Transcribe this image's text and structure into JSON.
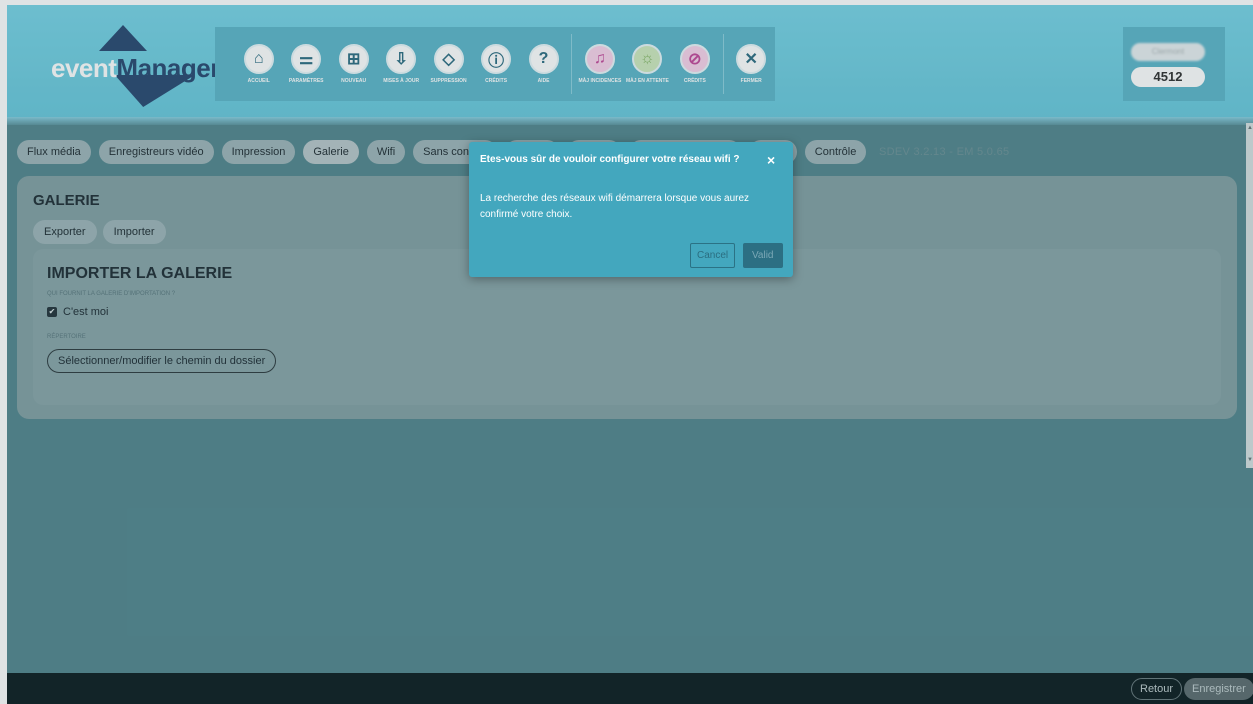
{
  "header": {
    "logo": {
      "text_left": "event",
      "text_right": "Manager"
    },
    "toolbar": [
      {
        "label": "ACCUEIL",
        "icon": "home-icon"
      },
      {
        "label": "PARAMÈTRES",
        "icon": "sliders-icon"
      },
      {
        "label": "NOUVEAU",
        "icon": "plus-square-icon"
      },
      {
        "label": "MISES À JOUR",
        "icon": "download-icon"
      },
      {
        "label": "SUPPRESSION",
        "icon": "eraser-icon"
      },
      {
        "label": "CRÉDITS",
        "icon": "info-icon"
      },
      {
        "label": "AIDE",
        "icon": "help-icon"
      },
      {
        "label": "MÀJ INCIDENCES",
        "icon": "bell-icon"
      },
      {
        "label": "MÀJ EN ATTENTE",
        "icon": "lightbulb-icon"
      },
      {
        "label": "CRÉDITS",
        "icon": "crossed-out-icon"
      },
      {
        "label": "FERMER",
        "icon": "close-circle-icon"
      }
    ],
    "account": {
      "name": "Clermont",
      "number": "4512"
    }
  },
  "tabs": [
    "Flux média",
    "Enregistreurs vidéo",
    "Impression",
    "Galerie",
    "Wifi",
    "Sans contact",
    "",
    "",
    "",
    "",
    "Contrôle"
  ],
  "active_tab": "Galerie",
  "version": "SDEV 3.2.13 - EM 5.0.65",
  "gallery": {
    "title": "GALERIE",
    "sub_tabs": [
      "Exporter",
      "Importer"
    ],
    "import": {
      "title": "IMPORTER LA GALERIE",
      "question": "QUI FOURNIT LA GALERIE D'IMPORTATION ?",
      "checkbox_label": "C'est moi",
      "directory_label": "RÉPERTOIRE",
      "path_button": "Sélectionner/modifier le chemin du dossier"
    }
  },
  "footer": {
    "back": "Retour",
    "save": "Enregistrer"
  },
  "modal": {
    "title": "Etes-vous sûr de vouloir configurer votre réseau wifi ?",
    "close": "×",
    "body": "La recherche des réseaux wifi démarrera lorsque vous aurez confirmé votre choix.",
    "cancel": "Cancel",
    "valid": "Valid"
  },
  "colors": {
    "header": "#79d4e6",
    "accent": "#43a7be",
    "background": "#558890",
    "footer": "#0f1f23"
  }
}
